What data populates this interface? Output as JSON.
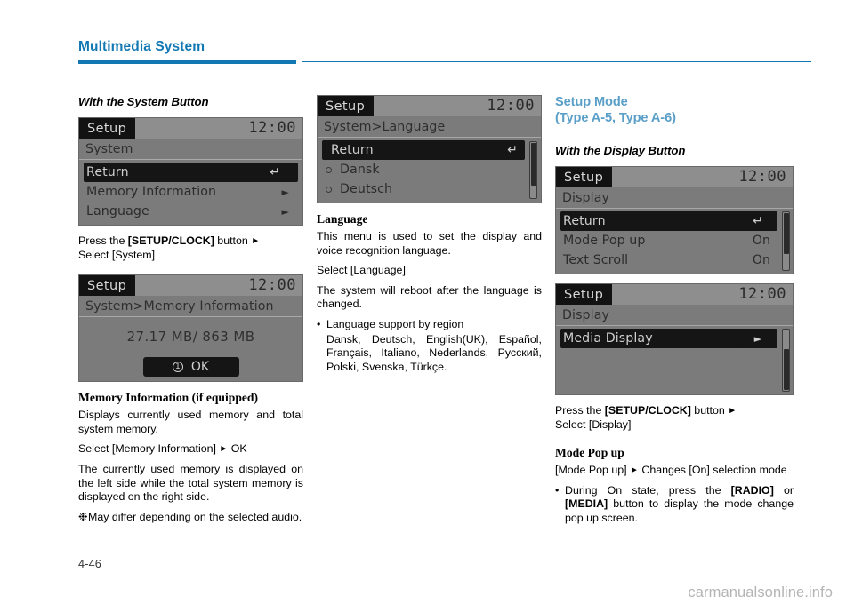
{
  "header": {
    "title": "Multimedia System"
  },
  "footer": {
    "page_number": "4-46",
    "watermark": "carmanualsonline.info"
  },
  "colors": {
    "header_blue": "#1278b4",
    "heading_blue": "#5a9fc8",
    "lcd_background": "#7b7b7b",
    "lcd_titlebar": "#8e8e8e",
    "lcd_selected": "#151515"
  },
  "column_left": {
    "heading": "With the System Button",
    "screen_system": {
      "title_tag": "Setup",
      "clock": "12:00",
      "breadcrumb": "System",
      "rows": [
        {
          "label": "Return",
          "selected": true,
          "accessory": "return-glyph"
        },
        {
          "label": "Memory Information",
          "selected": false,
          "accessory": "arrow"
        },
        {
          "label": "Language",
          "selected": false,
          "accessory": "arrow"
        }
      ]
    },
    "instruction_1_pre": "Press the ",
    "instruction_1_bold": "[SETUP/CLOCK]",
    "instruction_1_post": " button ",
    "instruction_2": "Select [System]",
    "screen_memory": {
      "title_tag": "Setup",
      "clock": "12:00",
      "breadcrumb": "System>Memory Information",
      "value": "27.17 MB/ 863 MB",
      "ok_badge": "1",
      "ok_label": "OK"
    },
    "section_heading": "Memory Information (if equipped)",
    "para_1": "Displays currently used memory and total system memory.",
    "para_2_pre": "Select [Memory Information] ",
    "para_2_post": " OK",
    "para_3": "The currently used memory is displayed on the left side while the total system memory is displayed on the right side.",
    "note_mark": "❉",
    "note_text": "May differ depending on the selected audio."
  },
  "column_middle": {
    "screen_language": {
      "title_tag": "Setup",
      "clock": "12:00",
      "breadcrumb": "System>Language",
      "rows": [
        {
          "label": "Return",
          "selected": true,
          "accessory": "return-glyph"
        },
        {
          "label": "Dansk",
          "selected": false,
          "accessory": "radio"
        },
        {
          "label": "Deutsch",
          "selected": false,
          "accessory": "radio"
        }
      ]
    },
    "section_heading": "Language",
    "para_1": "This menu is used to set the display and voice recognition language.",
    "para_2": "Select [Language]",
    "para_3": "The system will reboot after the language is changed.",
    "bullet_mark": "•",
    "bullet_text": "Language support by region",
    "language_list": "Dansk, Deutsch, English(UK), Español, Français, Italiano, Nederlands, Русский, Polski, Svenska, Türkçe."
  },
  "column_right": {
    "heading_blue_line1": "Setup Mode",
    "heading_blue_line2": "(Type A-5, Type A-6)",
    "heading_italic": "With the Display Button",
    "screen_display_1": {
      "title_tag": "Setup",
      "clock": "12:00",
      "breadcrumb": "Display",
      "rows": [
        {
          "label": "Return",
          "value": "",
          "selected": true,
          "accessory": "return-glyph"
        },
        {
          "label": "Mode Pop up",
          "value": "On",
          "selected": false,
          "accessory": "none"
        },
        {
          "label": "Text Scroll",
          "value": "On",
          "selected": false,
          "accessory": "none"
        }
      ]
    },
    "screen_display_2": {
      "title_tag": "Setup",
      "clock": "12:00",
      "breadcrumb": "Display",
      "rows": [
        {
          "label": "Media Display",
          "value": "",
          "selected": true,
          "accessory": "arrow-box"
        }
      ]
    },
    "instruction_1_pre": "Press the ",
    "instruction_1_bold": "[SETUP/CLOCK]",
    "instruction_1_post": " button ",
    "instruction_2": "Select [Display]",
    "section_heading": "Mode Pop up",
    "para_1_pre": "[Mode Pop up] ",
    "para_1_post": " Changes [On] selection mode",
    "bullet_mark": "•",
    "bullet_pre": "During On state, press the ",
    "bullet_bold_1": "[RADIO]",
    "bullet_mid": " or ",
    "bullet_bold_2": "[MEDIA]",
    "bullet_post": " button to display the mode change pop up screen."
  }
}
